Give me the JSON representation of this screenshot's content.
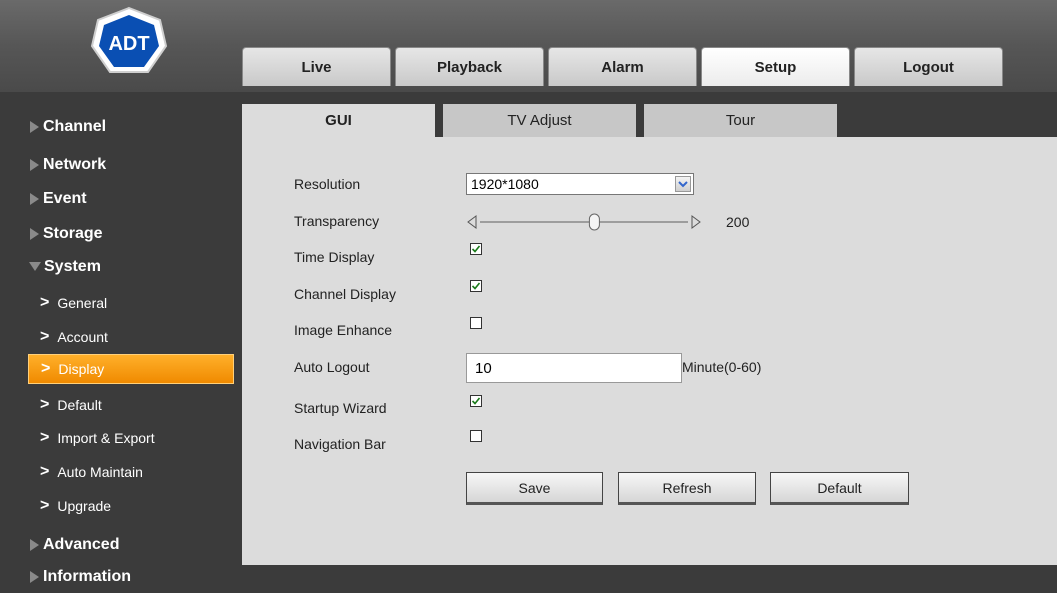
{
  "logo": {
    "text": "ADT",
    "color": "#0a4fb3"
  },
  "topnav": [
    {
      "label": "Live"
    },
    {
      "label": "Playback"
    },
    {
      "label": "Alarm"
    },
    {
      "label": "Setup",
      "active": true
    },
    {
      "label": "Logout"
    }
  ],
  "sidebar": {
    "groups": {
      "channel": "Channel",
      "network": "Network",
      "event": "Event",
      "storage": "Storage",
      "system": "System",
      "advanced": "Advanced",
      "information": "Information"
    },
    "system_items": [
      "General",
      "Account",
      "Display",
      "Default",
      "Import & Export",
      "Auto Maintain",
      "Upgrade"
    ],
    "active_item": "Display",
    "active_color": "#f7a21b"
  },
  "subtabs": [
    "GUI",
    "TV Adjust",
    "Tour"
  ],
  "form": {
    "resolution": {
      "label": "Resolution",
      "value": "1920*1080"
    },
    "transparency": {
      "label": "Transparency",
      "value": "200",
      "level": 0.55
    },
    "time_display": {
      "label": "Time Display",
      "checked": true
    },
    "channel_display": {
      "label": "Channel Display",
      "checked": true
    },
    "image_enhance": {
      "label": "Image Enhance",
      "checked": false
    },
    "auto_logout": {
      "label": "Auto Logout",
      "value": "10",
      "unit": "Minute(0-60)"
    },
    "startup_wizard": {
      "label": "Startup Wizard",
      "checked": true
    },
    "navigation_bar": {
      "label": "Navigation Bar",
      "checked": false
    }
  },
  "buttons": {
    "save": "Save",
    "refresh": "Refresh",
    "default": "Default"
  }
}
